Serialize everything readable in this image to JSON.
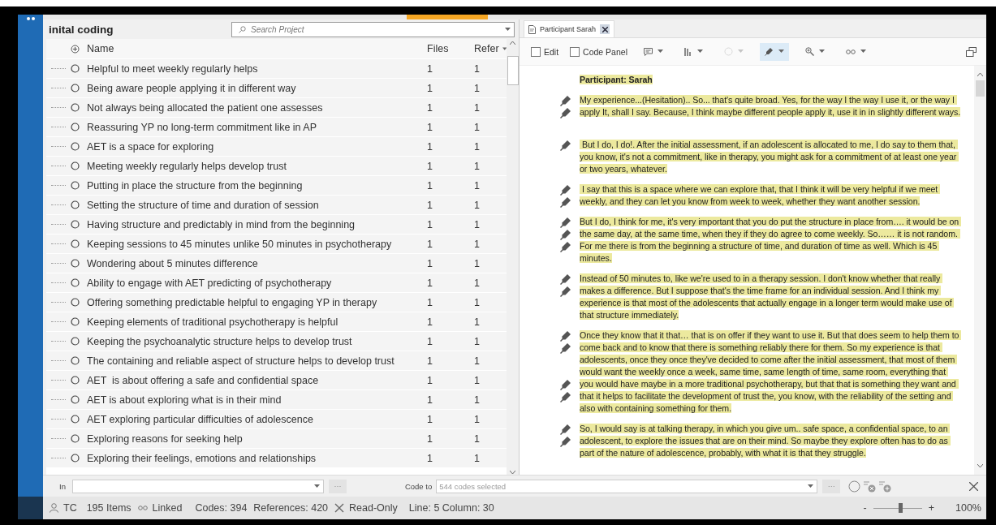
{
  "codes_panel": {
    "title": "inital coding",
    "search": {
      "placeholder": "Search Project"
    },
    "columns": [
      "Name",
      "Files",
      "Refer"
    ],
    "rows": [
      {
        "name": "Helpful to meet weekly regularly helps",
        "files": "1",
        "refs": "1"
      },
      {
        "name": "Being aware people applying it in different way",
        "files": "1",
        "refs": "1"
      },
      {
        "name": "Not always being allocated the patient one assesses",
        "files": "1",
        "refs": "1"
      },
      {
        "name": "Reassuring YP no long-term commitment like in AP",
        "files": "1",
        "refs": "1"
      },
      {
        "name": "AET is a space for exploring",
        "files": "1",
        "refs": "1"
      },
      {
        "name": "Meeting weekly regularly helps develop trust",
        "files": "1",
        "refs": "1"
      },
      {
        "name": "Putting in place the structure from the beginning",
        "files": "1",
        "refs": "1"
      },
      {
        "name": "Setting the structure of time and duration of session",
        "files": "1",
        "refs": "1"
      },
      {
        "name": "Having structure and predictably in mind from the beginning",
        "files": "1",
        "refs": "1"
      },
      {
        "name": "Keeping sessions to 45 minutes unlike 50 minutes in psychotherapy",
        "files": "1",
        "refs": "1"
      },
      {
        "name": "Wondering about 5 minutes difference",
        "files": "1",
        "refs": "1"
      },
      {
        "name": "Ability to engage with AET predicting of psychotherapy",
        "files": "1",
        "refs": "1"
      },
      {
        "name": "Offering something predictable helpful to engaging YP in therapy",
        "files": "1",
        "refs": "1"
      },
      {
        "name": "Keeping elements of traditional psychotherapy is helpful",
        "files": "1",
        "refs": "1"
      },
      {
        "name": "Keeping the psychoanalytic structure helps to develop trust",
        "files": "1",
        "refs": "1"
      },
      {
        "name": "The containing and reliable aspect of structure helps to develop trust",
        "files": "1",
        "refs": "1"
      },
      {
        "name": "AET  is about offering a safe and confidential space",
        "files": "1",
        "refs": "1"
      },
      {
        "name": "AET is about exploring what is in their mind",
        "files": "1",
        "refs": "1"
      },
      {
        "name": "AET exploring particular difficulties of adolescence",
        "files": "1",
        "refs": "1"
      },
      {
        "name": "Exploring reasons for seeking help",
        "files": "1",
        "refs": "1"
      },
      {
        "name": "Exploring their feelings, emotions and relationships",
        "files": "1",
        "refs": "1"
      }
    ]
  },
  "document": {
    "tab": {
      "label": "Participant Sarah"
    },
    "edit": {
      "label": "Edit",
      "checked": false
    },
    "code_panel": {
      "label": "Code Panel",
      "checked": false
    },
    "toolbar": [
      {
        "kind": "annotation",
        "selected": false,
        "disabled": false
      },
      {
        "kind": "stripes",
        "selected": false,
        "disabled": false
      },
      {
        "kind": "shading",
        "selected": false,
        "disabled": true
      },
      {
        "kind": "highlight",
        "selected": true,
        "disabled": false
      },
      {
        "kind": "zoom",
        "selected": false,
        "disabled": false
      },
      {
        "kind": "links",
        "selected": false,
        "disabled": false
      }
    ],
    "paragraphs": [
      {
        "kind": "heading",
        "text": "Participant: Sarah",
        "coded": [
          false
        ]
      },
      {
        "kind": "speech",
        "text": "My experience...(Hesitation).. So... that's quite broad. Yes, for the way I the way I use it, or the way I apply It, shall I say. Because, I think maybe different people apply it, use it in in slightly different ways.",
        "coded": [
          true,
          true,
          false
        ]
      },
      {
        "kind": "speech",
        "text": " But I do, I do!. After the initial assessment, if an adolescent is allocated to me, I do say to them that, you know, it's not a commitment, like in therapy, you might ask for a commitment of at least one year or two years, whatever.",
        "coded": [
          true,
          false,
          false
        ]
      },
      {
        "kind": "speech",
        "text": " I say that this is a space where we can explore that, that I think it will be very helpful if we meet weekly, and they can let you know from week to week, whether they want another session.",
        "coded": [
          true,
          true
        ]
      },
      {
        "kind": "speech",
        "text": "But I do, I think for me, it's very important that you do put the structure in place from…. it would be on the same day, at the same time, when they if they do agree to come weekly. So…… it is not random. For me there is from the beginning a structure of time, and duration of time as well. Which is 45 minutes.",
        "coded": [
          true,
          true,
          true,
          false
        ]
      },
      {
        "kind": "speech",
        "text": "Instead of 50 minutes to, like we're used to in a therapy session. I don't know whether that really makes a difference. But I suppose that's the time frame for an individual session. And I think my experience is that most of the adolescents that actually engage in a longer term would make use of that structure immediately.",
        "coded": [
          true,
          true,
          false,
          false
        ]
      },
      {
        "kind": "speech",
        "text": "Once they know that it that… that is on offer if they want to use it. But that does seem to help them to come back and to know that there is something reliably there for them. So my experience is that adolescents, once they once they've decided to come after the initial assessment, that most of them would want the weekly once a week, same time, same length of time, same room, everything that you would have maybe in a more traditional psychotherapy, but that that is something they want and that it helps to facilitate the development of trust the, you know, with the reliability of the setting and also with containing something for them.",
        "coded": [
          true,
          true,
          false,
          false,
          true,
          true,
          false
        ]
      },
      {
        "kind": "speech",
        "text": "So, I would say is at talking therapy, in which you give um.. safe space, a confidential space, to an adolescent, to explore the issues that are on their mind. So maybe they explore often has to do as part of the nature of adolescence, probably, with what it is that they struggle.",
        "coded": [
          true,
          true,
          false
        ]
      }
    ]
  },
  "bottom_bar": {
    "in_label": "In",
    "more": "···",
    "code_to_label": "Code to",
    "code_to": {
      "placeholder": "544 codes selected"
    },
    "more_2": "···"
  },
  "status_bar": {
    "user": "TC",
    "items": "195 Items",
    "linked": "Linked",
    "codes": "Codes: 394",
    "references": "References: 420",
    "read_only": "Read-Only",
    "position": "Line: 5 Column: 30",
    "zoom_out": "-",
    "zoom_in": "+",
    "zoom": {
      "level": 0.55
    },
    "zoom_reading": "100%"
  }
}
